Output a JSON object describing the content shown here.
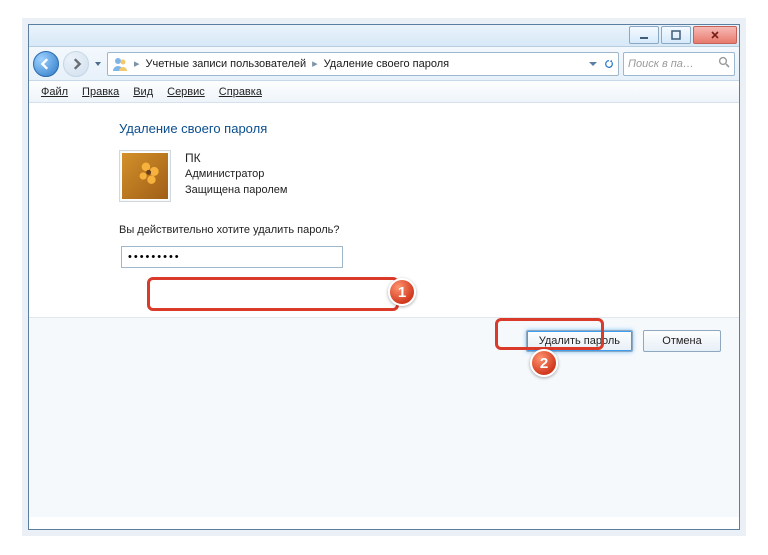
{
  "titlebar": {
    "min": "—",
    "max": "▢",
    "close": "✕"
  },
  "breadcrumb": {
    "level1": "Учетные записи пользователей",
    "level2": "Удаление своего пароля"
  },
  "search": {
    "placeholder": "Поиск в па…"
  },
  "menu": {
    "file": "Файл",
    "edit": "Правка",
    "view": "Вид",
    "tools": "Сервис",
    "help": "Справка"
  },
  "heading": "Удаление своего пароля",
  "user": {
    "name": "ПК",
    "role": "Администратор",
    "status": "Защищена паролем"
  },
  "prompt": "Вы действительно хотите удалить пароль?",
  "password_value": "•••••••••",
  "buttons": {
    "primary": "Удалить пароль",
    "cancel": "Отмена"
  },
  "callouts": {
    "one": "1",
    "two": "2"
  }
}
